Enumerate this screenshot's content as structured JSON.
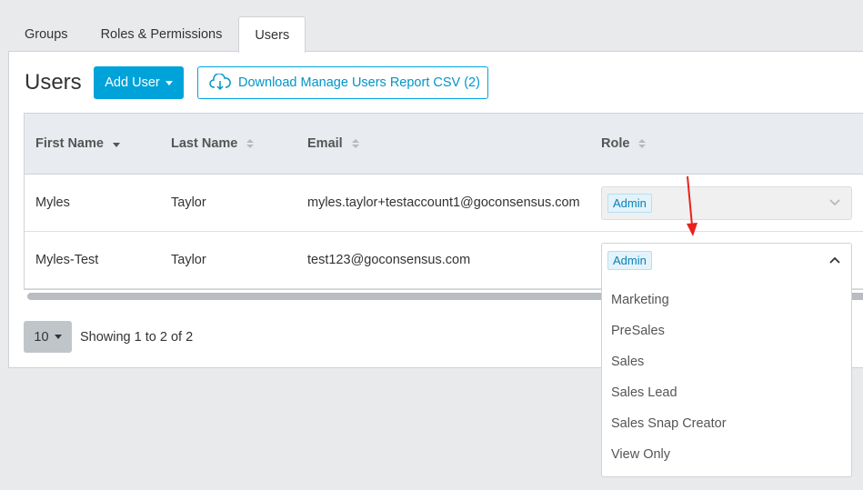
{
  "tabs": [
    {
      "label": "Groups",
      "active": false
    },
    {
      "label": "Roles & Permissions",
      "active": false
    },
    {
      "label": "Users",
      "active": true
    }
  ],
  "page_title": "Users",
  "toolbar": {
    "add_user_label": "Add User",
    "download_label": "Download Manage Users Report CSV (2)",
    "download_icon": "cloud-download-icon"
  },
  "table": {
    "columns": [
      "First Name",
      "Last Name",
      "Email",
      "Role"
    ],
    "sorted_column": "First Name",
    "rows": [
      {
        "first_name": "Myles",
        "last_name": "Taylor",
        "email": "myles.taylor+testaccount1@goconsensus.com",
        "role": "Admin"
      },
      {
        "first_name": "Myles-Test",
        "last_name": "Taylor",
        "email": "test123@goconsensus.com",
        "role": "Admin"
      }
    ]
  },
  "pagination": {
    "page_size": "10",
    "showing_text": "Showing 1 to 2 of 2"
  },
  "role_dropdown": {
    "selected": "Admin",
    "options": [
      "Marketing",
      "PreSales",
      "Sales",
      "Sales Lead",
      "Sales Snap Creator",
      "View Only"
    ]
  },
  "colors": {
    "accent": "#00a3d9",
    "annotation_arrow": "#e8221c"
  }
}
